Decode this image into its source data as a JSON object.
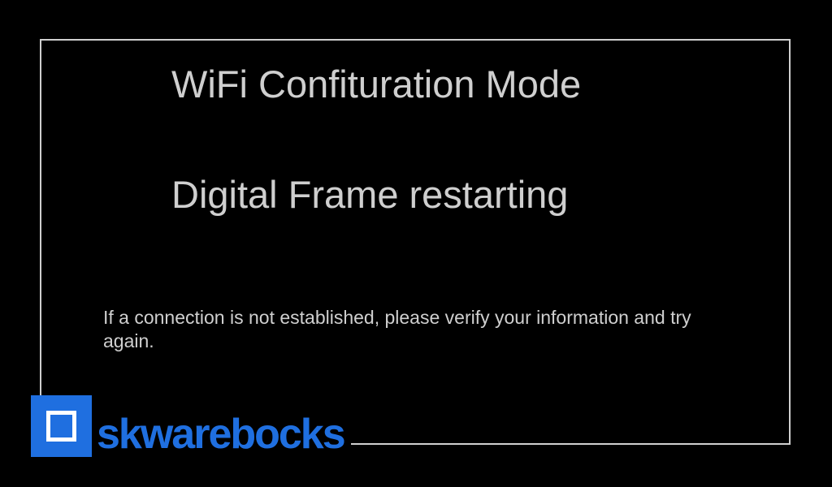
{
  "screen": {
    "title": "WiFi Confituration Mode",
    "status": "Digital Frame restarting",
    "note": "If a connection is not established, please verify your information and try again."
  },
  "brand": {
    "name": "skwarebocks",
    "icon": "square-logo-icon",
    "color": "#1f6fe0"
  },
  "colors": {
    "background": "#000000",
    "text": "#cfcfcf",
    "border": "#cfcfcf"
  }
}
